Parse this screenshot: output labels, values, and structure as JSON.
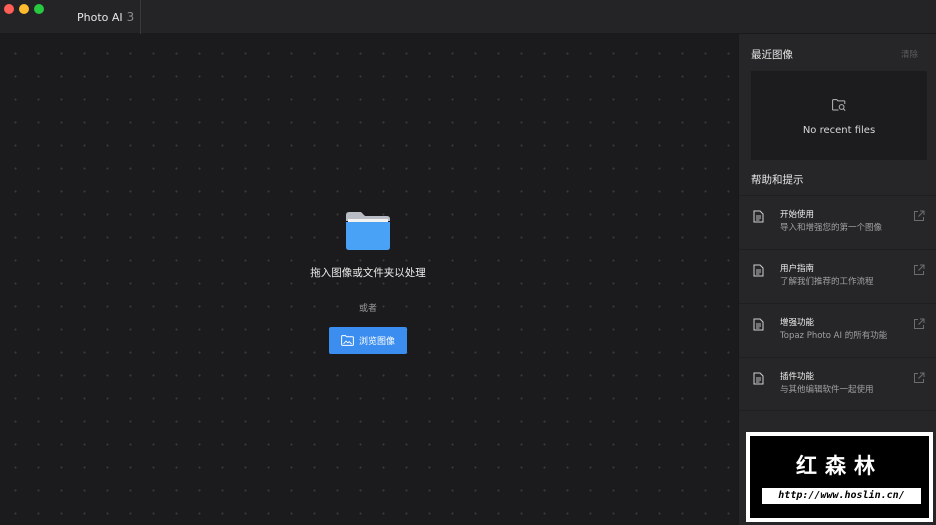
{
  "window": {
    "app_name": "Photo AI",
    "app_version": "3"
  },
  "canvas": {
    "drop_text": "拖入图像或文件夹以处理",
    "or_text": "或者",
    "browse_label": "浏览图像"
  },
  "sidebar": {
    "recent_title": "最近图像",
    "clear_label": "清除",
    "no_recent": "No recent files",
    "help_title": "帮助和提示",
    "help_items": [
      {
        "title": "开始使用",
        "subtitle": "导入和增强您的第一个图像"
      },
      {
        "title": "用户指南",
        "subtitle": "了解我们推荐的工作流程"
      },
      {
        "title": "增强功能",
        "subtitle": "Topaz Photo AI 的所有功能"
      },
      {
        "title": "插件功能",
        "subtitle": "与其他编辑软件一起使用"
      }
    ]
  },
  "watermark": {
    "title": "红森林",
    "url": "http://www.hoslin.cn/"
  },
  "colors": {
    "accent": "#3b8ef0",
    "folder": "#4aa2f6",
    "close": "#ff5f57",
    "minimize": "#febc2e",
    "maximize": "#28c840"
  }
}
